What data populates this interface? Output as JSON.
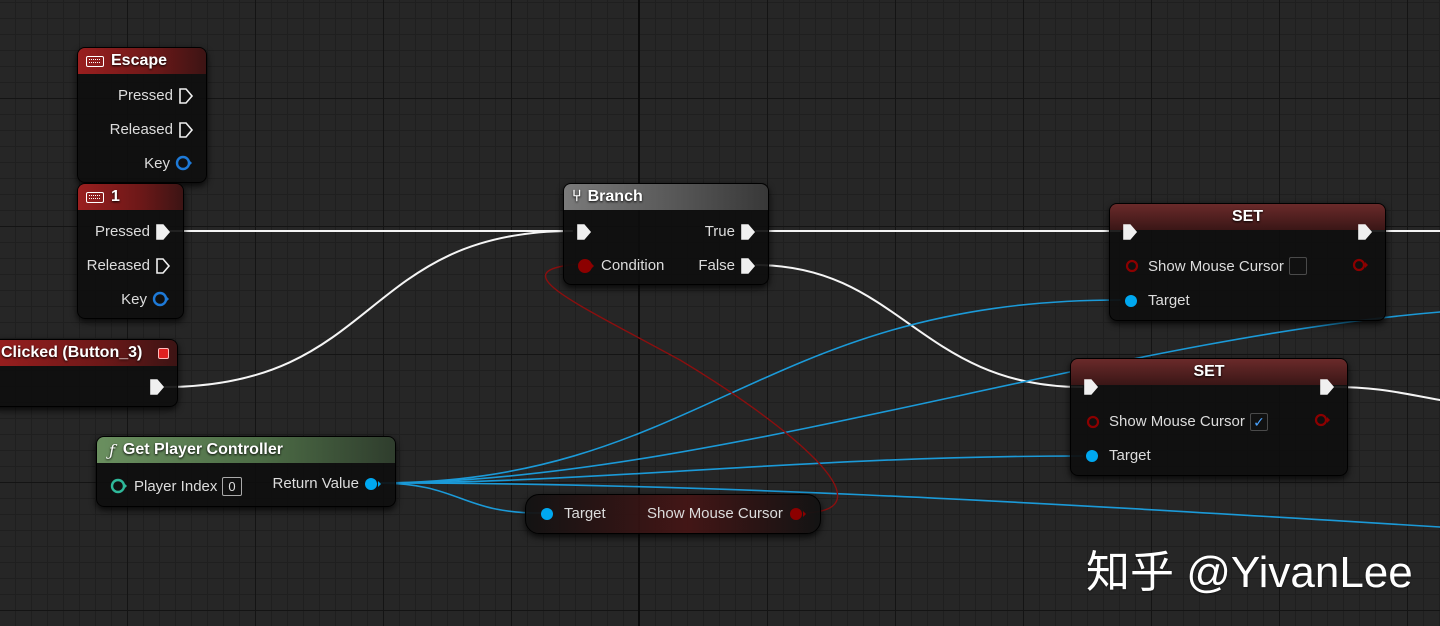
{
  "nodes": {
    "escape": {
      "title": "Escape",
      "pins": [
        "Pressed",
        "Released",
        "Key"
      ]
    },
    "key1": {
      "title": "1",
      "pins": [
        "Pressed",
        "Released",
        "Key"
      ]
    },
    "clicked": {
      "title": "Clicked (Button_3)"
    },
    "branch": {
      "title": "Branch",
      "true_label": "True",
      "condition_label": "Condition",
      "false_label": "False"
    },
    "set1": {
      "title": "SET",
      "property_label": "Show Mouse Cursor",
      "checked": false,
      "target_label": "Target"
    },
    "set2": {
      "title": "SET",
      "property_label": "Show Mouse Cursor",
      "checked": true,
      "target_label": "Target"
    },
    "get_player_controller": {
      "title": "Get Player Controller",
      "player_index_label": "Player Index",
      "player_index_value": "0",
      "return_label": "Return Value"
    },
    "get_show_cursor": {
      "target_label": "Target",
      "property_label": "Show Mouse Cursor"
    }
  },
  "colors": {
    "exec_wire": "#ffffff",
    "object_wire": "#1b9ad8",
    "bool_wire": "#8a0f0f",
    "bool_pin": "#8c0000",
    "object_pin": "#00a8f0",
    "struct_pin": "#2fb89a"
  },
  "watermark": "知乎 @YivanLee",
  "checkmark_glyph": "✓"
}
